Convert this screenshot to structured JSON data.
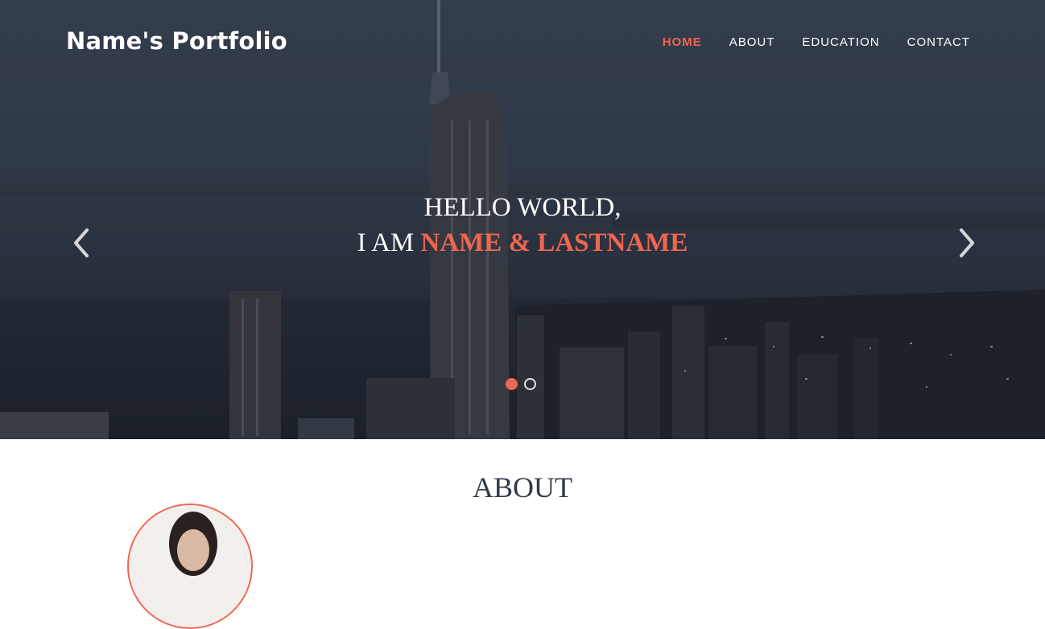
{
  "brand": {
    "title": "Name's Portfolio"
  },
  "nav": {
    "items": [
      {
        "label": "HOME",
        "active": true
      },
      {
        "label": "ABOUT",
        "active": false
      },
      {
        "label": "EDUCATION",
        "active": false
      },
      {
        "label": "CONTACT",
        "active": false
      }
    ]
  },
  "hero": {
    "line1": "HELLO WORLD,",
    "line2_prefix": "I AM ",
    "line2_highlight": "NAME & LASTNAME",
    "prev_icon": "chevron-left-icon",
    "next_icon": "chevron-right-icon",
    "slides": [
      {
        "active": true
      },
      {
        "active": false
      }
    ]
  },
  "about": {
    "title": "ABOUT"
  },
  "colors": {
    "accent": "#ef6650",
    "heading": "#2e3a48",
    "nav_text": "#ffffff"
  }
}
